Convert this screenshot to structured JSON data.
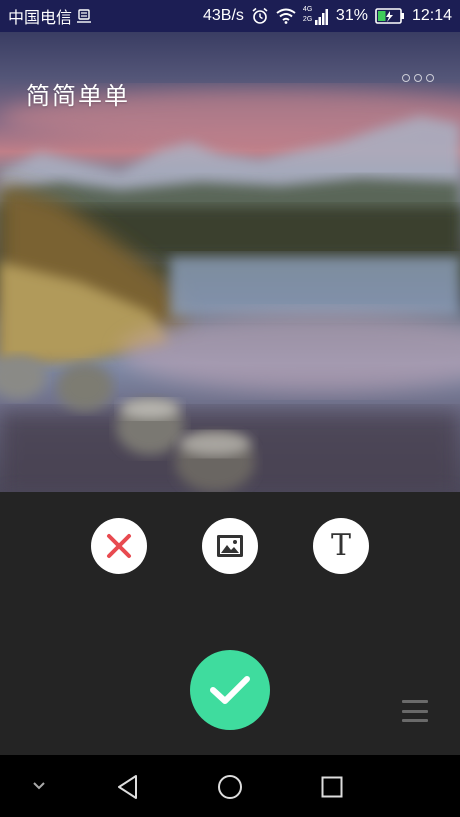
{
  "status_bar": {
    "carrier": "中国电信",
    "net_speed": "43B/s",
    "signal_labels": [
      "4G",
      "2G"
    ],
    "battery": "31%",
    "time": "12:14"
  },
  "header": {
    "app_title": "简简单单",
    "more_icon": "more-dots-icon"
  },
  "toolbar": {
    "buttons": [
      {
        "name": "close",
        "icon": "close-x-icon",
        "color": "#e84a50"
      },
      {
        "name": "image",
        "icon": "image-icon",
        "color": "#333333"
      },
      {
        "name": "text",
        "icon": "text-t-icon",
        "glyph": "T",
        "color": "#333333"
      }
    ],
    "confirm": {
      "icon": "checkmark-icon",
      "color": "#3fdc9e"
    },
    "menu_icon": "hamburger-menu-icon"
  },
  "nav_bar": {
    "items": [
      "collapse-chevron-icon",
      "back-triangle-icon",
      "home-circle-icon",
      "recents-square-icon"
    ]
  }
}
